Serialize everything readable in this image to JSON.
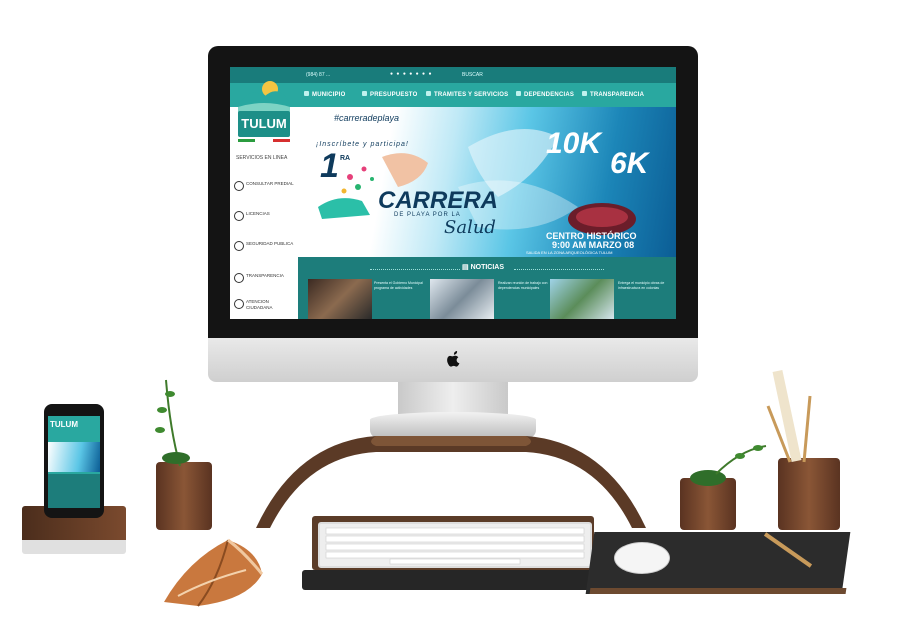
{
  "site": {
    "logo_name": "TULUM",
    "topbar": {
      "phone": "(984) 87 ...",
      "search": "BUSCAR"
    },
    "nav": [
      {
        "label": "MUNICIPIO"
      },
      {
        "label": "PRESUPUESTO"
      },
      {
        "label": "TRAMITES Y SERVICIOS"
      },
      {
        "label": "DEPENDENCIAS"
      },
      {
        "label": "TRANSPARENCIA"
      }
    ],
    "sidebar": {
      "title": "SERVICIOS EN LINEA",
      "items": [
        {
          "label": "CONSULTAR PREDIAL"
        },
        {
          "label": "LICENCIAS"
        },
        {
          "label": "SEGURIDAD PUBLICA"
        },
        {
          "label": "TRANSPARENCIA"
        },
        {
          "label": "ATENCION CIUDADANA"
        }
      ]
    },
    "banner": {
      "hashtag": "#carreradeplaya",
      "invite": "¡Inscríbete y participa!",
      "number": "1",
      "superscript": "RA",
      "title": "CARRERA",
      "subtitle": "DE PLAYA POR LA",
      "script": "Salud",
      "distance_a": "10K",
      "distance_b": "6K",
      "location": "CENTRO HISTÓRICO",
      "time": "9:00 AM MARZO 08",
      "note": "SALIDA EN LA ZONA ARQUEOLÓGICA TULUM"
    },
    "news": {
      "heading": "NOTICIAS",
      "items": [
        {
          "text": "Presenta el Gobierno Municipal programa de actividades"
        },
        {
          "text": "Realizan reunión de trabajo con dependencias municipales"
        },
        {
          "text": "Entrega el municipio obras de infraestructura en colonias"
        }
      ]
    }
  },
  "colors": {
    "teal": "#29a8a0",
    "teal_dark": "#197c7b",
    "navy": "#0e3a5c",
    "wood": "#6d4a30"
  }
}
